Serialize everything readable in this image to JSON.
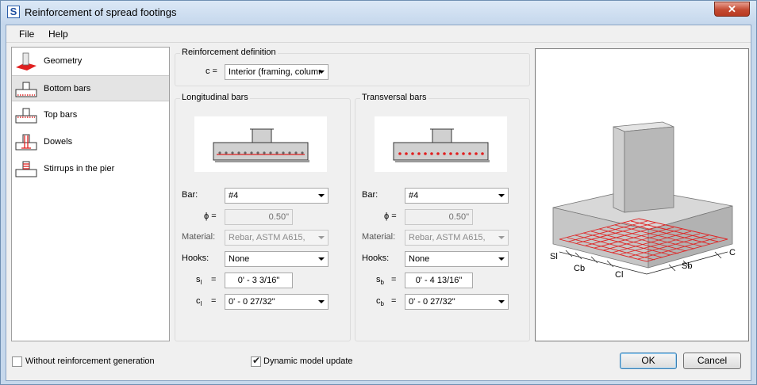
{
  "window": {
    "title": "Reinforcement of spread footings",
    "app_icon_letter": "S",
    "close_glyph": "✕"
  },
  "menu": {
    "file": "File",
    "help": "Help"
  },
  "nav": {
    "items": [
      {
        "label": "Geometry"
      },
      {
        "label": "Bottom bars"
      },
      {
        "label": "Top bars"
      },
      {
        "label": "Dowels"
      },
      {
        "label": "Stirrups in the pier"
      }
    ],
    "selected_index": 1
  },
  "reinforcement_definition": {
    "title": "Reinforcement definition",
    "c_label": "c =",
    "c_value": "Interior (framing, columr"
  },
  "longitudinal": {
    "title": "Longitudinal bars",
    "bar_label": "Bar:",
    "bar_value": "#4",
    "phi_label": "ϕ =",
    "phi_value": "0.50\"",
    "material_label": "Material:",
    "material_value": "Rebar, ASTM A615,",
    "hooks_label": "Hooks:",
    "hooks_value": "None",
    "s_label": "s",
    "s_sub": "l",
    "s_eq": "=",
    "s_value": "0' - 3 3/16\"",
    "c_label": "c",
    "c_sub": "l",
    "c_eq": "=",
    "c_value": "0' - 0 27/32\""
  },
  "transversal": {
    "title": "Transversal bars",
    "bar_label": "Bar:",
    "bar_value": "#4",
    "phi_label": "ϕ =",
    "phi_value": "0.50\"",
    "material_label": "Material:",
    "material_value": "Rebar, ASTM A615,",
    "hooks_label": "Hooks:",
    "hooks_value": "None",
    "s_label": "s",
    "s_sub": "b",
    "s_eq": "=",
    "s_value": "0' - 4 13/16\"",
    "c_label": "c",
    "c_sub": "b",
    "c_eq": "=",
    "c_value": "0' - 0 27/32\""
  },
  "model_labels": {
    "sl": "Sl",
    "cb": "Cb",
    "cl": "Cl",
    "sb": "Sb",
    "c": "C"
  },
  "footer": {
    "without_reinforcement": "Without reinforcement generation",
    "without_reinforcement_checked": false,
    "dynamic_update": "Dynamic model update",
    "dynamic_update_checked": true,
    "ok": "OK",
    "cancel": "Cancel"
  },
  "colors": {
    "rebar": "#e02020",
    "accent": "#3c7fb1"
  }
}
